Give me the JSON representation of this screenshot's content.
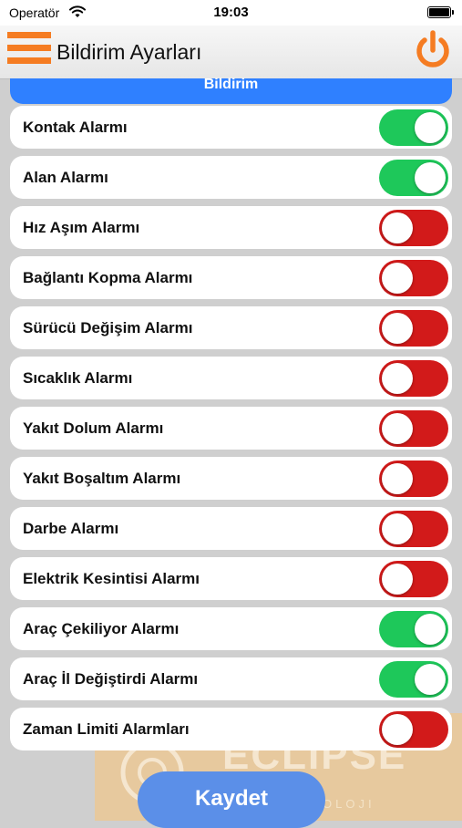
{
  "status_bar": {
    "carrier": "Operatör",
    "time": "19:03"
  },
  "nav": {
    "title": "Bildirim Ayarları"
  },
  "tab": {
    "label": "Bildirim"
  },
  "colors": {
    "on": "#1ec85a",
    "off": "#d21a1a",
    "accent": "#f57c22",
    "tab": "#2f80ff"
  },
  "alarms": [
    {
      "label": "Kontak Alarmı",
      "enabled": true
    },
    {
      "label": "Alan Alarmı",
      "enabled": true
    },
    {
      "label": "Hız Aşım Alarmı",
      "enabled": false
    },
    {
      "label": "Bağlantı Kopma Alarmı",
      "enabled": false
    },
    {
      "label": "Sürücü Değişim Alarmı",
      "enabled": false
    },
    {
      "label": "Sıcaklık Alarmı",
      "enabled": false
    },
    {
      "label": "Yakıt Dolum Alarmı",
      "enabled": false
    },
    {
      "label": "Yakıt Boşaltım Alarmı",
      "enabled": false
    },
    {
      "label": "Darbe Alarmı",
      "enabled": false
    },
    {
      "label": "Elektrik Kesintisi Alarmı",
      "enabled": false
    },
    {
      "label": "Araç Çekiliyor Alarmı",
      "enabled": true
    },
    {
      "label": "Araç İl Değiştirdi Alarmı",
      "enabled": true
    },
    {
      "label": "Zaman Limiti Alarmları",
      "enabled": false
    }
  ],
  "watermark": {
    "text": "ECLIPSE",
    "subtext": "OLOJI"
  },
  "footer": {
    "save_label": "Kaydet"
  }
}
